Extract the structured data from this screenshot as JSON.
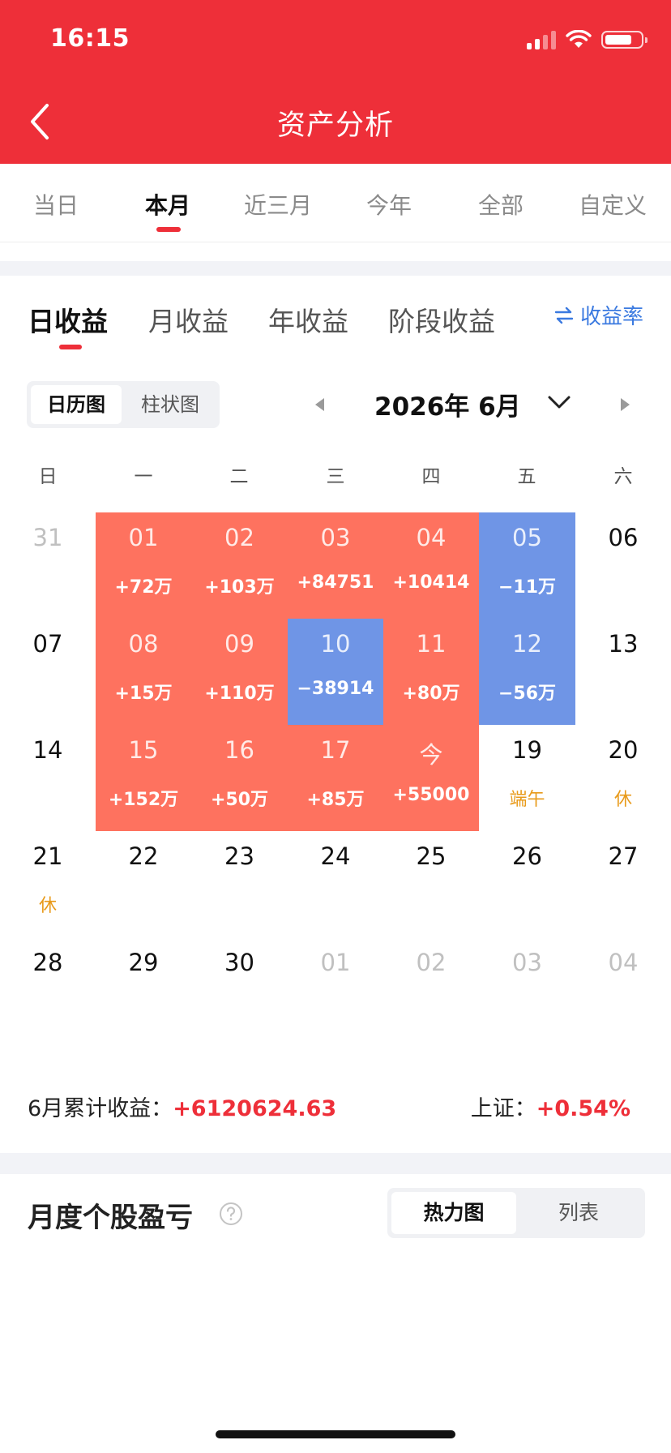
{
  "status_bar": {
    "time": "16:15"
  },
  "header": {
    "title": "资产分析"
  },
  "range_tabs": [
    "当日",
    "本月",
    "近三月",
    "今年",
    "全部",
    "自定义"
  ],
  "range_active": 1,
  "type_tabs": [
    "日收益",
    "月收益",
    "年收益",
    "阶段收益"
  ],
  "type_active": 0,
  "rate_button": {
    "icon": "swap-arrows-icon",
    "label": "收益率"
  },
  "view_toggle": [
    "日历图",
    "柱状图"
  ],
  "view_active": 0,
  "month": {
    "label": "2026年 6月"
  },
  "weekdays": [
    "日",
    "一",
    "二",
    "三",
    "四",
    "五",
    "六"
  ],
  "calendar": [
    [
      {
        "num": "31",
        "other": true
      },
      {
        "num": "01",
        "val": "+72万",
        "type": "gain"
      },
      {
        "num": "02",
        "val": "+103万",
        "type": "gain"
      },
      {
        "num": "03",
        "val": "+84751",
        "type": "gain"
      },
      {
        "num": "04",
        "val": "+10414",
        "type": "gain"
      },
      {
        "num": "05",
        "val": "−11万",
        "type": "loss"
      },
      {
        "num": "06"
      }
    ],
    [
      {
        "num": "07"
      },
      {
        "num": "08",
        "val": "+15万",
        "type": "gain"
      },
      {
        "num": "09",
        "val": "+110万",
        "type": "gain"
      },
      {
        "num": "10",
        "val": "−38914",
        "type": "loss"
      },
      {
        "num": "11",
        "val": "+80万",
        "type": "gain"
      },
      {
        "num": "12",
        "val": "−56万",
        "type": "loss"
      },
      {
        "num": "13"
      }
    ],
    [
      {
        "num": "14"
      },
      {
        "num": "15",
        "val": "+152万",
        "type": "gain"
      },
      {
        "num": "16",
        "val": "+50万",
        "type": "gain"
      },
      {
        "num": "17",
        "val": "+85万",
        "type": "gain"
      },
      {
        "num": "今",
        "val": "+55000",
        "type": "gain"
      },
      {
        "num": "19",
        "note": "端午"
      },
      {
        "num": "20",
        "note": "休"
      }
    ],
    [
      {
        "num": "21",
        "note": "休"
      },
      {
        "num": "22"
      },
      {
        "num": "23"
      },
      {
        "num": "24"
      },
      {
        "num": "25"
      },
      {
        "num": "26"
      },
      {
        "num": "27"
      }
    ],
    [
      {
        "num": "28"
      },
      {
        "num": "29"
      },
      {
        "num": "30"
      },
      {
        "num": "01",
        "other": true
      },
      {
        "num": "02",
        "other": true
      },
      {
        "num": "03",
        "other": true
      },
      {
        "num": "04",
        "other": true
      }
    ]
  ],
  "summary": {
    "label": "6月累计收益：",
    "value": "+6120624.63",
    "index_label": "上证：",
    "index_value": "+0.54%"
  },
  "section": {
    "title": "月度个股盈亏"
  },
  "heat_toggle": [
    "热力图",
    "列表"
  ],
  "heat_active": 0,
  "colors": {
    "brand_red": "#ee2f39",
    "gain": "#fe725f",
    "loss": "#6f95e6",
    "holiday": "#e89a1a",
    "link_blue": "#3b7ae0"
  }
}
